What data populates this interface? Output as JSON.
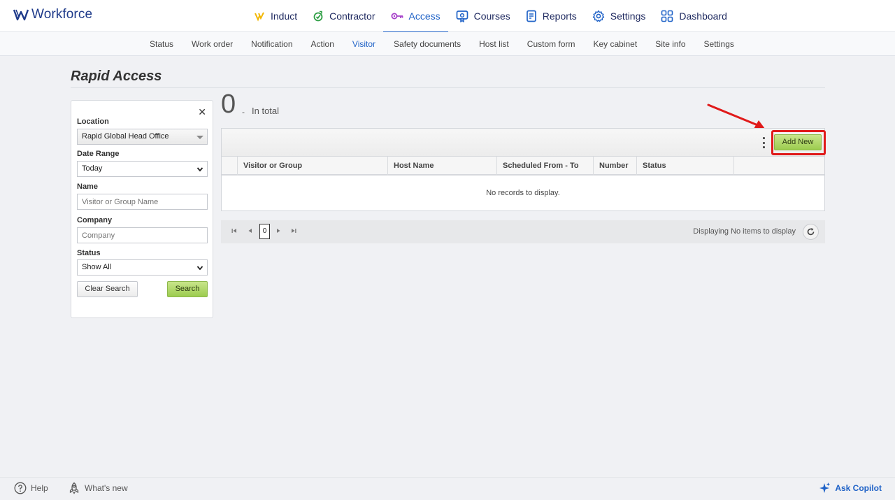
{
  "app": {
    "brand": "Workforce"
  },
  "main_nav": [
    {
      "key": "induct",
      "label": "Induct",
      "icon": "induct-icon",
      "color": "#f2b705"
    },
    {
      "key": "contractor",
      "label": "Contractor",
      "icon": "contractor-icon",
      "color": "#2e9e44"
    },
    {
      "key": "access",
      "label": "Access",
      "icon": "key-icon",
      "color": "#a641c9",
      "active": true
    },
    {
      "key": "courses",
      "label": "Courses",
      "icon": "courses-icon",
      "color": "#1f62c7"
    },
    {
      "key": "reports",
      "label": "Reports",
      "icon": "reports-icon",
      "color": "#1f62c7"
    },
    {
      "key": "settings",
      "label": "Settings",
      "icon": "gear-icon",
      "color": "#1f62c7"
    },
    {
      "key": "dashboard",
      "label": "Dashboard",
      "icon": "dashboard-icon",
      "color": "#1f62c7"
    }
  ],
  "sub_nav": [
    "Status",
    "Work order",
    "Notification",
    "Action",
    "Visitor",
    "Safety documents",
    "Host list",
    "Custom form",
    "Key cabinet",
    "Site info",
    "Settings"
  ],
  "sub_nav_active": "Visitor",
  "page": {
    "title": "Rapid Access"
  },
  "filter": {
    "location_label": "Location",
    "location_value": "Rapid Global Head Office",
    "date_range_label": "Date Range",
    "date_range_value": "Today",
    "name_label": "Name",
    "name_placeholder": "Visitor or Group Name",
    "company_label": "Company",
    "company_placeholder": "Company",
    "status_label": "Status",
    "status_value": "Show All",
    "clear_label": "Clear Search",
    "search_label": "Search",
    "close_glyph": "✕"
  },
  "summary": {
    "count": "0",
    "separator": "-",
    "text": "In total"
  },
  "grid": {
    "add_new_label": "Add New",
    "columns": [
      "Visitor or Group",
      "Host Name",
      "Scheduled From - To",
      "Number",
      "Status"
    ],
    "empty_message": "No records to display."
  },
  "pager": {
    "page_value": "0",
    "info": "Displaying No items to display"
  },
  "footer": {
    "help_label": "Help",
    "whats_new_label": "What's new",
    "copilot_label": "Ask Copilot"
  },
  "colors": {
    "accent": "#1f62c7",
    "button_green": "#9ccc4f",
    "highlight_red": "#e01a1a"
  }
}
